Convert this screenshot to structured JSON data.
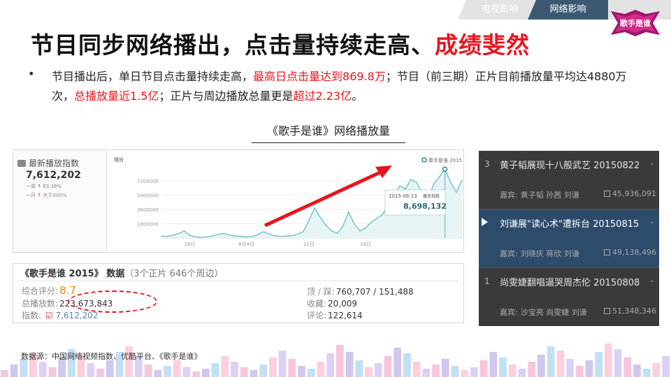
{
  "tabs": [
    {
      "label": "电视影响",
      "active": false
    },
    {
      "label": "网络影响",
      "active": true
    }
  ],
  "logo_text": "歌手是谁",
  "title": {
    "main": "节目同步网络播出，点击量持续走高、",
    "highlight": "成绩斐然"
  },
  "bullet": {
    "p1": "节目播出后，单日节目点击量持续走高，",
    "r1": "最高日点击量达到869.8万",
    "p2": "；节目（前三期）正片目前播放量平均达4880万次，",
    "r2": "总播放量近1.5亿",
    "p3": "；正片与周边播放总量更是",
    "r3": "超过2.23亿",
    "p4": "。"
  },
  "section_title": "《歌手是谁》网络播放量",
  "chart_widget": {
    "header": "最新播放指数",
    "value": "7,612,202",
    "week_label": "一周",
    "week_change": "83.38%",
    "month_label": "一月",
    "month_change": "大于500%",
    "y_unit": "播放",
    "legend": "歌手是谁 2015",
    "tooltip_date": "2015-08-23",
    "tooltip_label": "播放指数",
    "tooltip_value": "8,698,132"
  },
  "chart_data": {
    "type": "area",
    "title": "",
    "ylabel": "播放",
    "ylim": [
      0,
      9500000
    ],
    "yticks": [
      1800000,
      3600000,
      5400000,
      7200000
    ],
    "ytick_labels": [
      "1800000",
      "3600000",
      "5400000",
      "7200000"
    ],
    "xtick_labels": [
      "28日",
      "8月4日",
      "11日",
      "18日"
    ],
    "series": [
      {
        "name": "歌手是谁 2015",
        "values": [
          250000,
          200000,
          350000,
          550000,
          900000,
          350000,
          150000,
          100000,
          150000,
          300000,
          450000,
          600000,
          400000,
          250000,
          200000,
          150000,
          200000,
          450000,
          800000,
          500000,
          300000,
          200000,
          250000,
          300000,
          500000,
          800000,
          2200000,
          3800000,
          2600000,
          1600000,
          900000,
          600000,
          1500000,
          3300000,
          1800000,
          900000,
          1300000,
          2000000,
          2500000,
          3000000,
          4200000,
          5200000,
          6600000,
          6200000,
          7400000,
          7000000,
          5600000,
          4800000,
          6800000,
          7700000,
          8698132,
          7000000,
          5800000,
          7300000
        ]
      }
    ]
  },
  "data_table": {
    "title": "《歌手是谁 2015》 数据",
    "subtitle": "（3个正片 646个周边）",
    "rating_label": "综合评分:",
    "rating_value": "8.7",
    "total_label": "总播放数:",
    "total_value": "223,673,843",
    "index_label": "指数:",
    "index_value": "7,612,202",
    "updown_label": "顶 / 踩:",
    "updown_value": "760,707 / 151,488",
    "fav_label": "收藏:",
    "fav_value": "20,009",
    "comment_label": "评论:",
    "comment_value": "122,614"
  },
  "playlist": [
    {
      "num": "3",
      "title": "黄子韬展现十八般武艺 20150822",
      "guest_label": "嘉宾:",
      "guests": "黄子韬  孙茜  刘谦",
      "count": "45,936,091",
      "active": false
    },
    {
      "num": "",
      "title": "刘谦展\"读心术\"遭拆台 20150815",
      "guest_label": "嘉宾:",
      "guests": "刘晓庆  蒋欣  刘谦",
      "count": "49,138,496",
      "active": true
    },
    {
      "num": "1",
      "title": "尚雯婕翻唱逼哭周杰伦 20150808",
      "guest_label": "嘉宾:",
      "guests": "沙宝亮  尚雯婕  刘谦",
      "count": "51,348,346",
      "active": false
    }
  ],
  "source": "数据源：中国网络视频指数、优酷平台、《歌手是谁》",
  "colors": {
    "accent_red": "#e8151f",
    "tab_active": "#3b5a72",
    "playlist_active": "#2d4c6b",
    "chart_line": "#7ec6cc"
  }
}
